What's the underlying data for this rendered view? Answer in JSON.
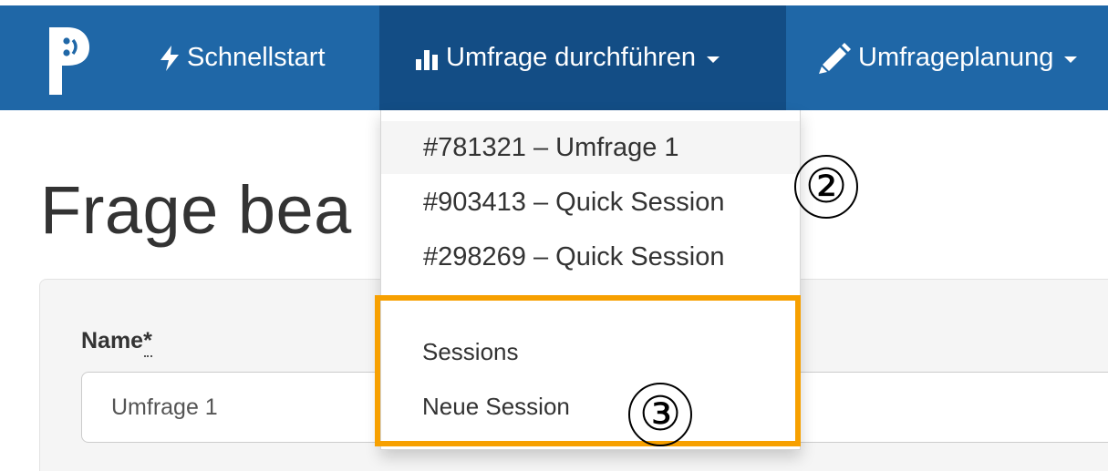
{
  "navbar": {
    "items": [
      {
        "label": "Schnellstart",
        "icon": "bolt-icon"
      },
      {
        "label": "Umfrage durchführen",
        "icon": "bar-chart-icon"
      },
      {
        "label": "Umfrageplanung",
        "icon": "pencil-icon"
      }
    ],
    "colors": {
      "background": "#1f67a7",
      "active": "#134d85"
    }
  },
  "page": {
    "title": "Frage bea"
  },
  "form": {
    "name_label": "Name",
    "required_mark": "*",
    "name_value": "Umfrage 1"
  },
  "dropdown": {
    "recent": [
      "#781321 – Umfrage 1",
      "#903413 – Quick Session",
      "#298269 – Quick Session"
    ],
    "actions": [
      "Sessions",
      "Neue Session"
    ]
  },
  "annotations": {
    "marker_dropdown": "②",
    "marker_actions": "③",
    "highlight_color": "#f7a000"
  }
}
